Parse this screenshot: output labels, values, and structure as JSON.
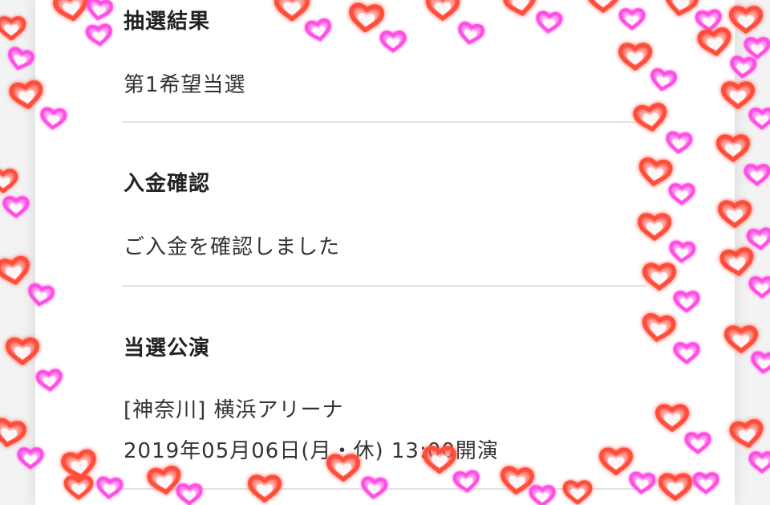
{
  "lottery": {
    "label": "抽選結果",
    "value": "第1希望当選"
  },
  "payment": {
    "label": "入金確認",
    "value": "ご入金を確認しました"
  },
  "performance": {
    "label": "当選公演",
    "venue": "[神奈川] 横浜アリーナ",
    "datetime": "2019年05月06日(月・休) 13:00開演"
  },
  "overlay": {
    "icon": "heart-icon",
    "colors": {
      "heart_red": "#ff4d3a",
      "heart_pink": "#ff4fe3"
    }
  }
}
